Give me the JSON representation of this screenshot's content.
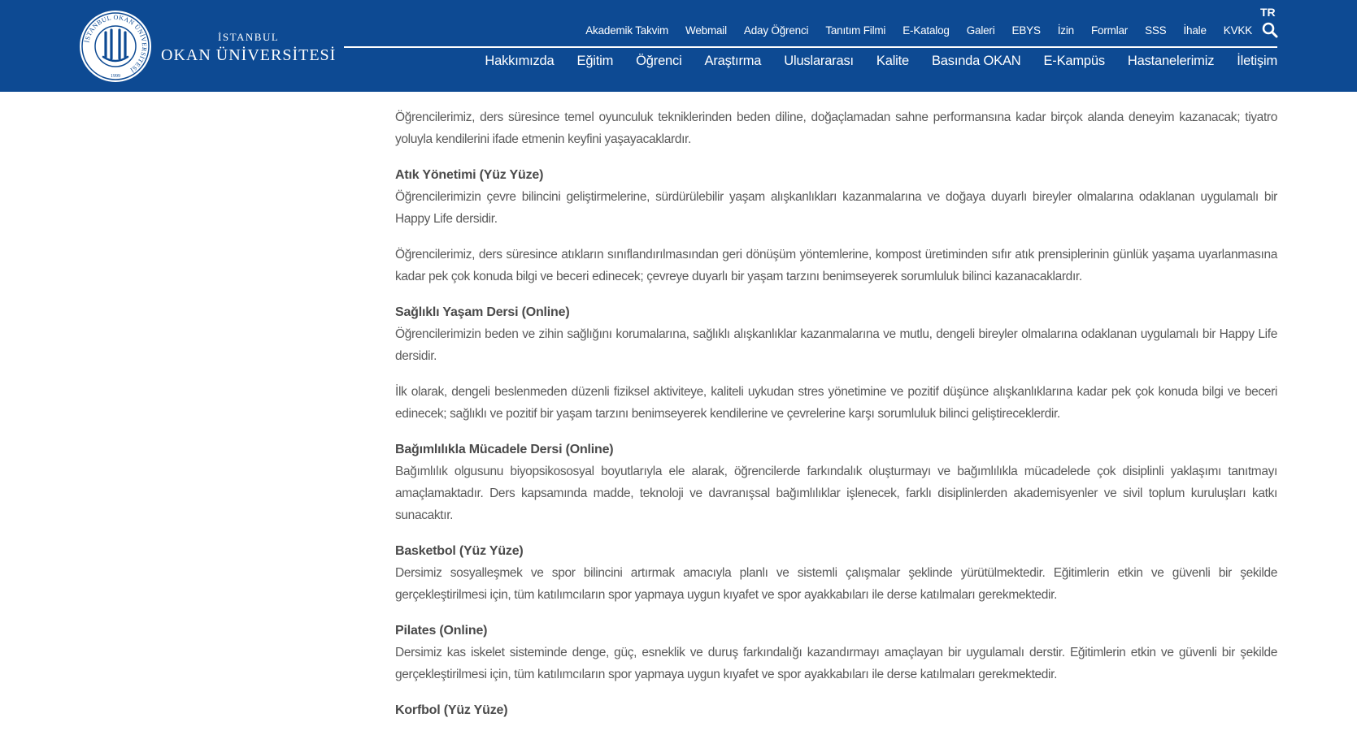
{
  "header": {
    "logo": {
      "seal_text": "İSTANBUL OKAN ÜNİVERSİTESİ",
      "seal_year": "1999",
      "line1": "İSTANBUL",
      "line2": "OKAN ÜNİVERSİTESİ"
    },
    "lang": "TR",
    "top_nav": [
      "Akademik Takvim",
      "Webmail",
      "Aday Öğrenci",
      "Tanıtım Filmi",
      "E-Katalog",
      "Galeri",
      "EBYS",
      "İzin",
      "Formlar",
      "SSS",
      "İhale",
      "KVKK"
    ],
    "main_nav": [
      "Hakkımızda",
      "Eğitim",
      "Öğrenci",
      "Araştırma",
      "Uluslararası",
      "Kalite",
      "Basında OKAN",
      "E-Kampüs",
      "Hastanelerimiz",
      "İletişim"
    ],
    "colors": {
      "header_bg": "#0d4a93",
      "text": "#ffffff"
    }
  },
  "content": {
    "intro": "Öğrencilerimiz, ders süresince temel oyunculuk tekniklerinden beden diline, doğaçlamadan sahne performansına kadar birçok alanda deneyim kazanacak; tiyatro yoluyla kendilerini ifade etmenin keyfini yaşayacaklardır.",
    "courses": [
      {
        "title": "Atık Yönetimi (Yüz Yüze)",
        "paragraphs": [
          "Öğrencilerimizin çevre bilincini geliştirmelerine, sürdürülebilir yaşam alışkanlıkları kazanmalarına ve doğaya duyarlı bireyler olmalarına odaklanan uygulamalı bir Happy Life dersidir.",
          "Öğrencilerimiz, ders süresince atıkların sınıflandırılmasından geri dönüşüm yöntemlerine, kompost üretiminden sıfır atık prensiplerinin günlük yaşama uyarlanmasına kadar pek çok konuda bilgi ve beceri edinecek; çevreye duyarlı bir yaşam tarzını benimseyerek sorumluluk bilinci kazanacaklardır."
        ]
      },
      {
        "title": "Sağlıklı Yaşam Dersi (Online)",
        "paragraphs": [
          "Öğrencilerimizin beden ve zihin sağlığını korumalarına, sağlıklı alışkanlıklar kazanmalarına ve mutlu, dengeli bireyler olmalarına odaklanan uygulamalı bir Happy Life dersidir.",
          "İlk olarak, dengeli beslenmeden düzenli fiziksel aktiviteye, kaliteli uykudan stres yönetimine ve pozitif düşünce alışkanlıklarına kadar pek çok konuda bilgi ve beceri edinecek; sağlıklı ve pozitif bir yaşam tarzını benimseyerek kendilerine ve çevrelerine karşı sorumluluk bilinci geliştireceklerdir."
        ]
      },
      {
        "title": "Bağımlılıkla Mücadele Dersi (Online)",
        "paragraphs": [
          "Bağımlılık olgusunu biyopsikososyal boyutlarıyla ele alarak, öğrencilerde farkındalık oluşturmayı ve bağımlılıkla mücadelede çok disiplinli yaklaşımı tanıtmayı amaçlamaktadır. Ders kapsamında madde, teknoloji ve davranışsal bağımlılıklar işlenecek, farklı disiplinlerden akademisyenler ve sivil toplum kuruluşları katkı sunacaktır."
        ]
      },
      {
        "title": "Basketbol (Yüz Yüze)",
        "paragraphs": [
          "Dersimiz sosyalleşmek ve spor bilincini artırmak amacıyla planlı ve sistemli çalışmalar şeklinde yürütülmektedir. Eğitimlerin etkin ve güvenli bir şekilde gerçekleştirilmesi için, tüm katılımcıların spor yapmaya uygun kıyafet ve spor ayakkabıları ile derse katılmaları gerekmektedir."
        ]
      },
      {
        "title": "Pilates (Online)",
        "paragraphs": [
          "Dersimiz kas iskelet sisteminde denge, güç, esneklik ve duruş farkındalığı kazandırmayı amaçlayan bir uygulamalı derstir. Eğitimlerin etkin ve güvenli bir şekilde gerçekleştirilmesi için, tüm katılımcıların spor yapmaya uygun kıyafet ve spor ayakkabıları ile derse katılmaları gerekmektedir."
        ]
      },
      {
        "title": "Korfbol (Yüz Yüze)",
        "paragraphs": []
      }
    ]
  }
}
